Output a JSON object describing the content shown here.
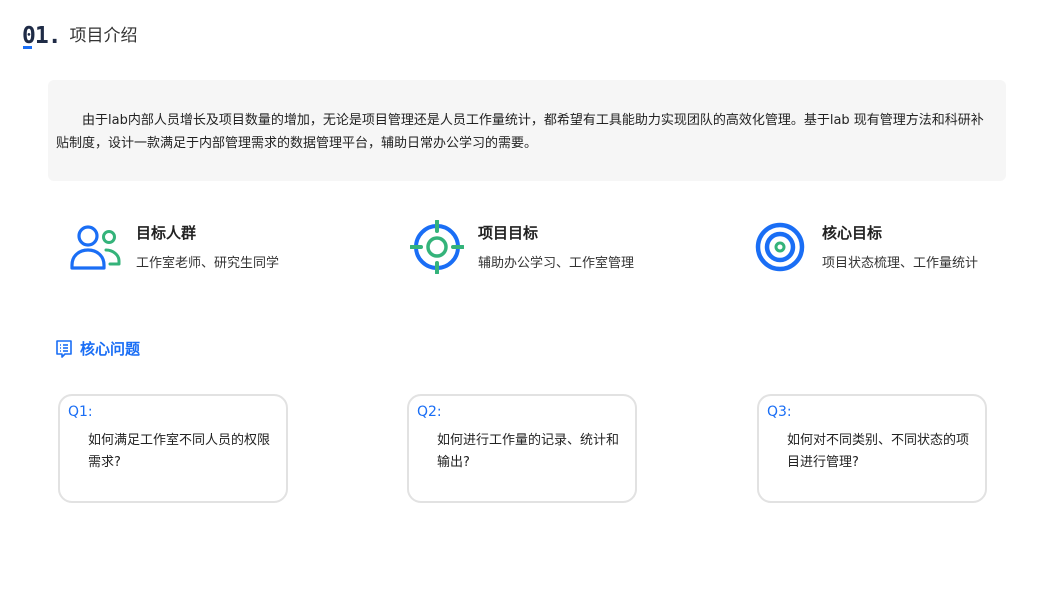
{
  "header": {
    "section_number": "01.",
    "title": "项目介绍"
  },
  "intro": {
    "text": "由于lab内部人员增长及项目数量的增加，无论是项目管理还是人员工作量统计，都希望有工具能助力实现团队的高效化管理。基于lab 现有管理方法和科研补贴制度，设计一款满足于内部管理需求的数据管理平台，辅助日常办公学习的需要。"
  },
  "goals": [
    {
      "title": "目标人群",
      "desc": "工作室老师、研究生同学",
      "icon": "user-group-icon"
    },
    {
      "title": "项目目标",
      "desc": "辅助办公学习、工作室管理",
      "icon": "crosshair-target-icon"
    },
    {
      "title": "核心目标",
      "desc": "项目状态梳理、工作量统计",
      "icon": "bullseye-icon"
    }
  ],
  "core": {
    "heading": "核心问题",
    "icon": "list-document-icon"
  },
  "questions": [
    {
      "label": "Q1:",
      "text": "如何满足工作室不同人员的权限需求?"
    },
    {
      "label": "Q2:",
      "text": "如何进行工作量的记录、统计和输出?"
    },
    {
      "label": "Q3:",
      "text": "如何对不同类别、不同状态的项目进行管理?"
    }
  ],
  "colors": {
    "accent_blue": "#1a6ef5",
    "accent_green": "#34b37a",
    "intro_background": "#f6f6f6",
    "card_border": "#e2e2e2"
  }
}
